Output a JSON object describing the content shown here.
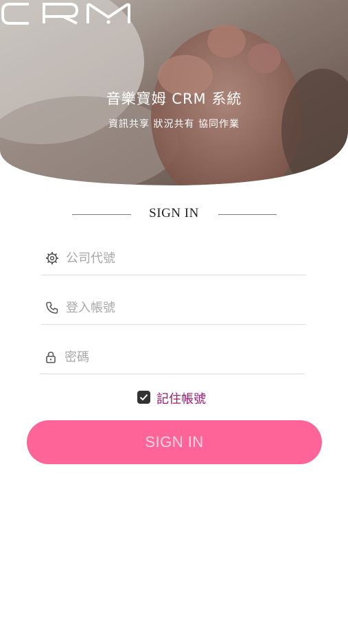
{
  "header": {
    "title": "音樂寶姆 CRM 系統",
    "tagline": "資訊共享 狀況共有 協同作業"
  },
  "form": {
    "heading": "SIGN IN",
    "company_placeholder": "公司代號",
    "account_placeholder": "登入帳號",
    "password_placeholder": "密碼",
    "remember_label": "記住帳號",
    "remember_checked": true,
    "submit_label": "SIGN IN"
  },
  "colors": {
    "accent": "#ff6498",
    "remember_text": "#9b1a6f"
  },
  "icons": [
    "crm-logo",
    "gear-icon",
    "phone-icon",
    "lock-icon",
    "checkbox-checked-icon"
  ]
}
